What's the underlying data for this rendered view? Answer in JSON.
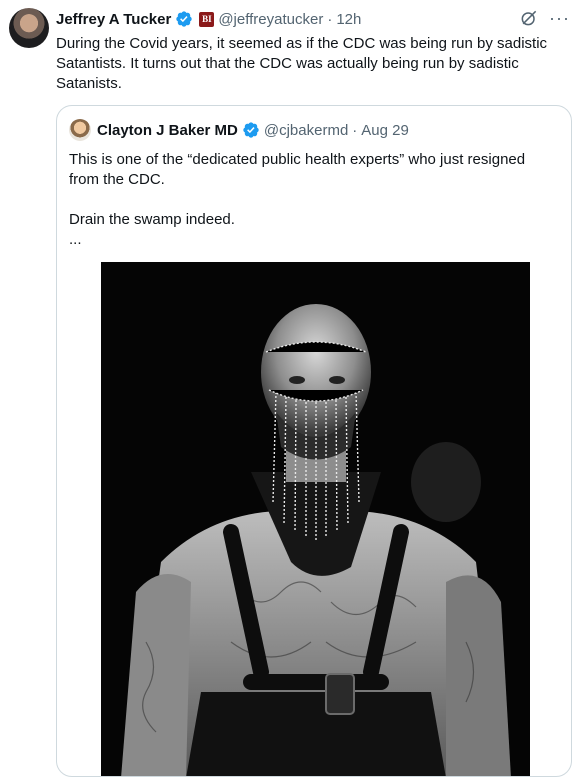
{
  "tweet": {
    "author_name": "Jeffrey A Tucker",
    "author_handle": "@jeffreyatucker",
    "separator": "·",
    "time": "12h",
    "brand_badge_text": "BI",
    "text": "During the Covid years, it seemed as if the CDC was being run by sadistic Satantists. It turns out that the CDC was actually being run by sadistic Satanists.",
    "more_icon": "···"
  },
  "quote": {
    "author_name": "Clayton J Baker MD",
    "author_handle": "@cjbakermd",
    "separator": "·",
    "date": "Aug 29",
    "line1": "This is one of the “dedicated public health experts” who just resigned from the CDC.",
    "line2": "Drain the swamp indeed.",
    "line3": "..."
  },
  "colors": {
    "verified": "#1d9bf0",
    "muted": "#536471",
    "border": "#cfd9de",
    "brand": "#8b1a1a"
  },
  "icons": [
    "verified-badge-icon",
    "grok-icon",
    "more-icon"
  ]
}
